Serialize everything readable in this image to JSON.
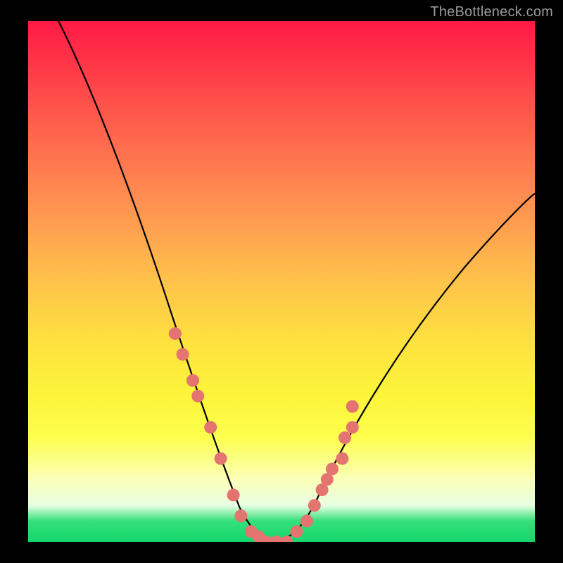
{
  "watermark": "TheBottleneck.com",
  "chart_data": {
    "type": "line",
    "title": "",
    "xlabel": "",
    "ylabel": "",
    "x_range_fraction": [
      0,
      1
    ],
    "ylim_percent": [
      0,
      100
    ],
    "background_gradient_stops": [
      {
        "pos": 0.0,
        "color": "#ff1a45",
        "meaning": "worst"
      },
      {
        "pos": 0.5,
        "color": "#ffc34a",
        "meaning": "mid"
      },
      {
        "pos": 0.8,
        "color": "#fdff4d",
        "meaning": "near-best"
      },
      {
        "pos": 1.0,
        "color": "#15d66a",
        "meaning": "best"
      }
    ],
    "series": [
      {
        "name": "bottleneck-curve",
        "color": "#000000",
        "x": [
          0.0,
          0.05,
          0.1,
          0.15,
          0.2,
          0.25,
          0.3,
          0.35,
          0.4,
          0.425,
          0.45,
          0.475,
          0.5,
          0.55,
          0.6,
          0.65,
          0.7,
          0.8,
          0.9,
          1.0
        ],
        "y_percent": [
          100,
          90,
          80,
          70,
          60,
          49,
          38,
          26,
          12,
          5,
          1,
          0,
          0,
          4,
          12,
          21,
          29,
          43,
          55,
          65
        ]
      }
    ],
    "markers": {
      "name": "highlighted-points",
      "color": "#e4746f",
      "radius_px": 9,
      "points_xy_percent": [
        [
          0.29,
          40
        ],
        [
          0.305,
          36
        ],
        [
          0.325,
          31
        ],
        [
          0.335,
          28
        ],
        [
          0.36,
          22
        ],
        [
          0.38,
          16
        ],
        [
          0.405,
          9
        ],
        [
          0.42,
          5
        ],
        [
          0.44,
          2
        ],
        [
          0.455,
          1
        ],
        [
          0.47,
          0
        ],
        [
          0.49,
          0
        ],
        [
          0.51,
          0
        ],
        [
          0.53,
          2
        ],
        [
          0.55,
          4
        ],
        [
          0.565,
          7
        ],
        [
          0.58,
          10
        ],
        [
          0.59,
          12
        ],
        [
          0.6,
          14
        ],
        [
          0.62,
          16
        ],
        [
          0.625,
          20
        ],
        [
          0.64,
          22
        ],
        [
          0.64,
          26
        ]
      ]
    }
  }
}
